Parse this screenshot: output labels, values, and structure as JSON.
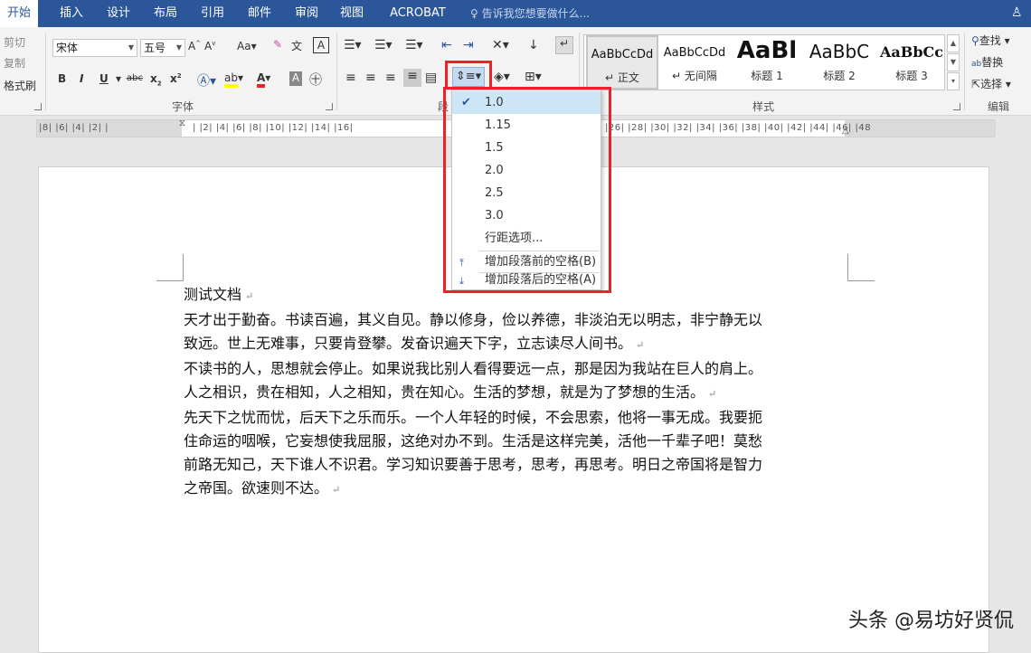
{
  "tabs": [
    {
      "label": "开始",
      "active": true
    },
    {
      "label": "插入"
    },
    {
      "label": "设计"
    },
    {
      "label": "布局"
    },
    {
      "label": "引用"
    },
    {
      "label": "邮件"
    },
    {
      "label": "审阅"
    },
    {
      "label": "视图"
    },
    {
      "label": "ACROBAT"
    }
  ],
  "tellme": "告诉我您想要做什么...",
  "clipboard": {
    "cut": "剪切",
    "copy": "复制",
    "format_painter": "格式刷"
  },
  "font": {
    "name": "宋体",
    "size": "五号",
    "group_label": "字体",
    "change_case": "Aa"
  },
  "paragraph": {
    "group_label": "段"
  },
  "styles": {
    "group_label": "样式",
    "items": [
      {
        "sample": "AaBbCcDd",
        "name": "正文",
        "selected": true
      },
      {
        "sample": "AaBbCcDd",
        "name": "无间隔"
      },
      {
        "sample": "AaBl",
        "name": "标题 1"
      },
      {
        "sample": "AaBbC",
        "name": "标题 2"
      },
      {
        "sample": "AaBbCc",
        "name": "标题 3"
      }
    ]
  },
  "editing": {
    "find": "查找",
    "replace": "替换",
    "select": "选择",
    "group_label": "编辑"
  },
  "ruler": {
    "left_ticks": "|8|  |6|  |4|  |2|  |",
    "mid_ticks": "|  |2|  |4|  |6|  |8|  |10|  |12|  |14|  |16|",
    "right_ticks": "|26|  |28|  |30|  |32|  |34|  |36|  |38|  |40|  |42|  |44|  |46|  |48"
  },
  "line_spacing_menu": {
    "options": [
      {
        "label": "1.0",
        "checked": true
      },
      {
        "label": "1.15"
      },
      {
        "label": "1.5"
      },
      {
        "label": "2.0"
      },
      {
        "label": "2.5"
      },
      {
        "label": "3.0"
      }
    ],
    "more_options": "行距选项...",
    "add_before": "增加段落前的空格(B)",
    "add_after": "增加段落后的空格(A)"
  },
  "document": {
    "title": "测试文档",
    "lines": [
      "天才出于勤奋。书读百遍，其义自见。静以修身，俭以养德，非淡泊无以明志，非宁静无以",
      "致远。世上无难事，只要肯登攀。发奋识遍天下字，立志读尽人间书。",
      "不读书的人，思想就会停止。如果说我比别人看得要远一点，那是因为我站在巨人的肩上。",
      "人之相识，贵在相知，人之相知，贵在知心。生活的梦想，就是为了梦想的生活。",
      "先天下之忧而忧，后天下之乐而乐。一个人年轻的时候，不会思索，他将一事无成。我要扼",
      "住命运的咽喉，它妄想使我屈服，这绝对办不到。生活是这样完美，活他一千辈子吧！莫愁",
      "前路无知己，天下谁人不识君。学习知识要善于思考，思考，再思考。明日之帝国将是智力",
      "之帝国。欲速则不达。"
    ],
    "paragraph_end_after": [
      1,
      3,
      7
    ]
  },
  "watermark": "头条 @易坊好贤侃",
  "colors": {
    "accent": "#2b579a",
    "highlight": "#e8232a"
  }
}
